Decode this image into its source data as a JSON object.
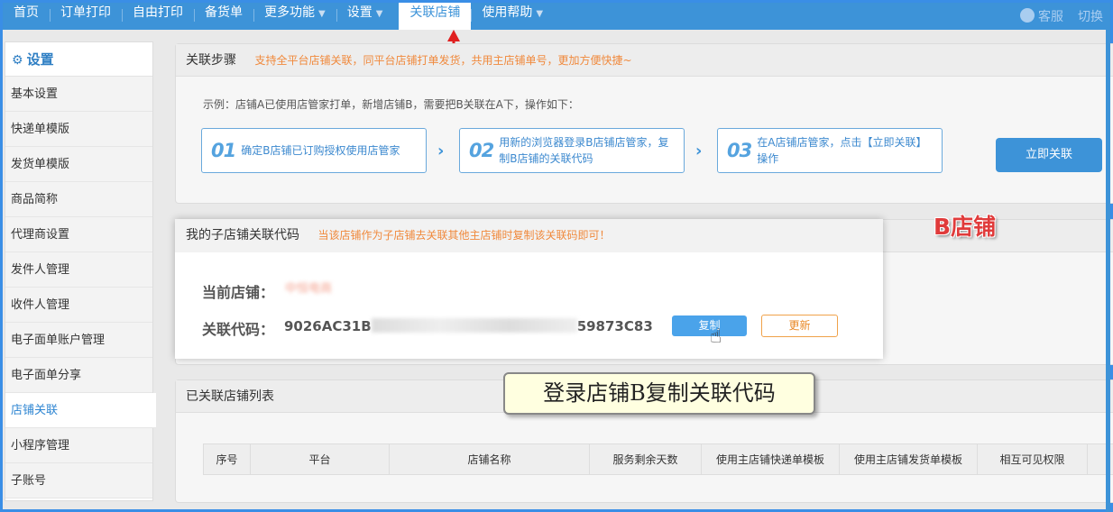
{
  "nav": {
    "items": [
      "首页",
      "订单打印",
      "自由打印",
      "备货单",
      "更多功能",
      "设置"
    ],
    "active": "关联店铺",
    "help": "使用帮助",
    "service": "客服",
    "switch": "切换"
  },
  "sidebar": {
    "title": "设置",
    "items": [
      "基本设置",
      "快递单模版",
      "发货单模版",
      "商品简称",
      "代理商设置",
      "发件人管理",
      "收件人管理",
      "电子面单账户管理",
      "电子面单分享",
      "店铺关联",
      "小程序管理",
      "子账号"
    ]
  },
  "steps_panel": {
    "title": "关联步骤",
    "tip": "支持全平台店铺关联，同平台店铺打单发货，共用主店铺单号，更加方便快捷~",
    "example": "示例：店铺A已使用店管家打单，新增店铺B，需要把B关联在A下，操作如下：",
    "steps": [
      {
        "num": "01",
        "text": "确定B店铺已订购授权使用店管家"
      },
      {
        "num": "02",
        "text": "用新的浏览器登录B店铺店管家，复制B店铺的关联代码"
      },
      {
        "num": "03",
        "text": "在A店铺店管家，点击【立即关联】操作"
      }
    ],
    "link_button": "立即关联"
  },
  "code_panel": {
    "title": "我的子店铺关联代码",
    "tip": "当该店铺作为子店铺去关联其他主店铺时复制该关联码即可！",
    "store_label": "当前店铺：",
    "store_name": "中恒电商",
    "code_label": "关联代码：",
    "code_prefix": "9026AC31B",
    "code_suffix": "59873C83",
    "copy_button": "复制",
    "refresh_button": "更新"
  },
  "b_label": {
    "letter": "B",
    "text": "店铺"
  },
  "callout": "登录店铺B复制关联代码",
  "list_panel": {
    "title": "已关联店铺列表",
    "columns": [
      "序号",
      "平台",
      "店铺名称",
      "服务剩余天数",
      "使用主店铺快递单模板",
      "使用主店铺发货单模板",
      "相互可见权限"
    ]
  },
  "colors": {
    "accent": "#3d93d8",
    "orange": "#f0893c",
    "red": "#e03b3b"
  }
}
